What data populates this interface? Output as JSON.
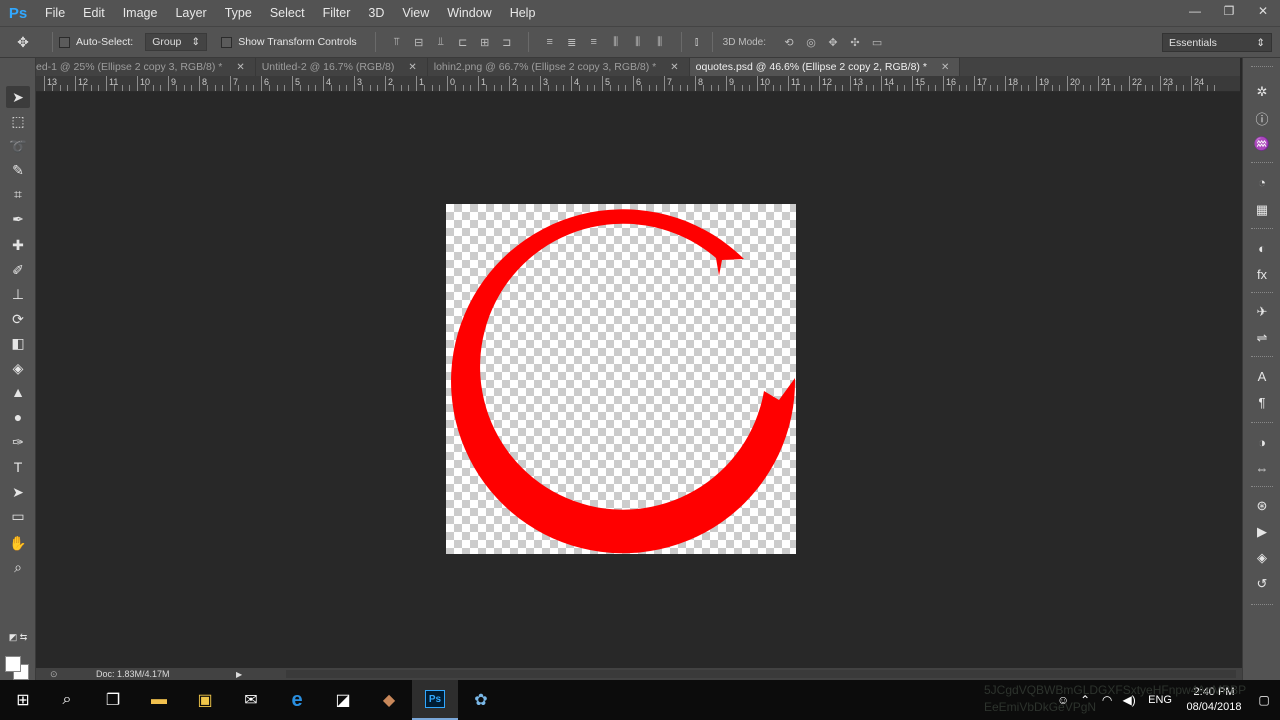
{
  "app": {
    "logo": "Ps"
  },
  "menu": [
    "File",
    "Edit",
    "Image",
    "Layer",
    "Type",
    "Select",
    "Filter",
    "3D",
    "View",
    "Window",
    "Help"
  ],
  "window_controls": {
    "minimize": "—",
    "restore": "❐",
    "close": "✕"
  },
  "options": {
    "auto_select_label": "Auto-Select:",
    "auto_select_value": "Group",
    "show_transform_label": "Show Transform Controls",
    "mode3d_label": "3D Mode:",
    "workspace": "Essentials"
  },
  "tabs": [
    {
      "label": "ed-1 @ 25% (Ellipse 2 copy 3, RGB/8) *",
      "active": false
    },
    {
      "label": "Untitled-2 @ 16.7% (RGB/8)",
      "active": false
    },
    {
      "label": "lohin2.png @ 66.7% (Ellipse 2 copy 3, RGB/8) *",
      "active": false
    },
    {
      "label": "oquotes.psd @ 46.6% (Ellipse 2 copy 2, RGB/8) *",
      "active": true
    }
  ],
  "ruler_labels": [
    "13",
    "12",
    "11",
    "10",
    "9",
    "8",
    "7",
    "6",
    "5",
    "4",
    "3",
    "2",
    "1",
    "0",
    "1",
    "2",
    "3",
    "4",
    "5",
    "6",
    "7",
    "8",
    "9",
    "10",
    "11",
    "12",
    "13",
    "14",
    "15",
    "16",
    "17",
    "18",
    "19",
    "20",
    "21",
    "22",
    "23",
    "24"
  ],
  "tools": [
    "move-icon",
    "marquee-icon",
    "lasso-icon",
    "quick-select-icon",
    "crop-icon",
    "eyedropper-icon",
    "healing-brush-icon",
    "brush-icon",
    "clone-stamp-icon",
    "history-brush-icon",
    "eraser-icon",
    "paint-bucket-icon",
    "blur-icon",
    "dodge-icon",
    "pen-icon",
    "type-icon",
    "path-select-icon",
    "rectangle-icon",
    "hand-icon",
    "zoom-icon"
  ],
  "dock_icons": [
    "gear-panel-icon",
    "info-icon",
    "brushes-icon",
    "color-icon",
    "swatches-icon",
    "adjustments-icon",
    "styles-icon",
    "tool-presets-icon",
    "properties-icon",
    "character-icon",
    "paragraph-icon",
    "3d-icon",
    "timeline-icon",
    "actions-icon",
    "play-icon",
    "layers-icon",
    "history-icon"
  ],
  "status": {
    "zoom": "⊙",
    "doc": "Doc: 1.83M/4.17M",
    "arrow": "▶"
  },
  "taskbar": {
    "clock_time": "2:40 PM",
    "clock_date": "08/04/2018",
    "language": "ENG",
    "overlay_line1": "5JCgdVQBWBmGLDGXFSxtyeHFnpw4AnMPBP",
    "overlay_line2": "EeEmiVbDkGeVPgN"
  },
  "colors": {
    "artwork": "#ff0000",
    "accent": "#31a8ff"
  }
}
